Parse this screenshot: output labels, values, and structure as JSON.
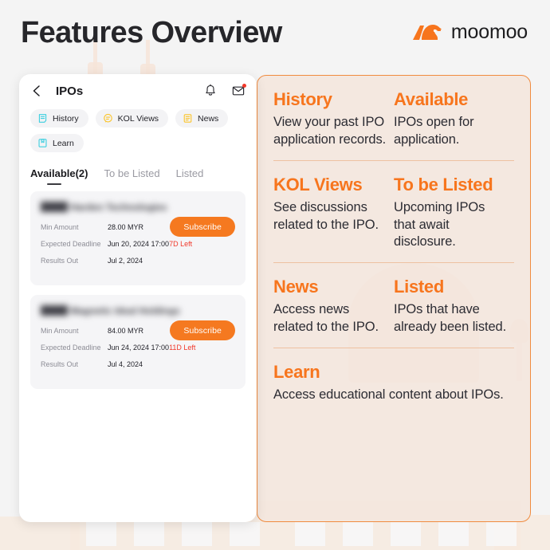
{
  "header": {
    "title": "Features Overview",
    "brand_name": "moomoo",
    "brand_color": "#f7751d"
  },
  "phone": {
    "topbar": {
      "back_icon": "chevron-left-icon",
      "title": "IPOs",
      "bell_icon": "bell-icon",
      "mail_icon": "mail-icon",
      "mail_badge": true
    },
    "chips": [
      {
        "label": "History",
        "icon": "document-lines-icon",
        "color": "#3ecfe0"
      },
      {
        "label": "KOL Views",
        "icon": "speech-bubble-icon",
        "color": "#fbc52d"
      },
      {
        "label": "News",
        "icon": "news-list-icon",
        "color": "#fbc52d"
      },
      {
        "label": "Learn",
        "icon": "bookmark-book-icon",
        "color": "#3ecfe0"
      }
    ],
    "tabs": [
      {
        "label": "Available(2)",
        "active": true
      },
      {
        "label": "To be Listed",
        "active": false
      },
      {
        "label": "Listed",
        "active": false
      }
    ],
    "ipo_cards": [
      {
        "name": "████ Harden Technologies",
        "min_amount_label": "Min Amount",
        "min_amount_value": "28.00 MYR",
        "deadline_label": "Expected Deadline",
        "deadline_value": "Jun 20, 2024 17:00 ",
        "days_left": "7D Left",
        "results_label": "Results Out",
        "results_value": "Jul 2, 2024",
        "button": "Subscribe"
      },
      {
        "name": "████ Magnetic Ideal Holdings",
        "min_amount_label": "Min Amount",
        "min_amount_value": "84.00 MYR",
        "deadline_label": "Expected Deadline",
        "deadline_value": "Jun 24, 2024 17:00 ",
        "days_left": "11D Left",
        "results_label": "Results Out",
        "results_value": "Jul 4, 2024",
        "button": "Subscribe"
      }
    ]
  },
  "features": {
    "accent_color": "#f7751d",
    "rows": [
      [
        {
          "title": "History",
          "desc": "View your past IPO application records."
        },
        {
          "title": "Available",
          "desc": " IPOs open for application."
        }
      ],
      [
        {
          "title": "KOL Views",
          "desc": "See discussions related to the IPO."
        },
        {
          "title": "To be Listed",
          "desc": "Upcoming IPOs that await disclosure."
        }
      ],
      [
        {
          "title": "News",
          "desc": "Access news related to the IPO."
        },
        {
          "title": "Listed",
          "desc": "IPOs that have already been listed."
        }
      ],
      [
        {
          "title": "Learn",
          "desc": "Access educational content about IPOs."
        }
      ]
    ]
  }
}
